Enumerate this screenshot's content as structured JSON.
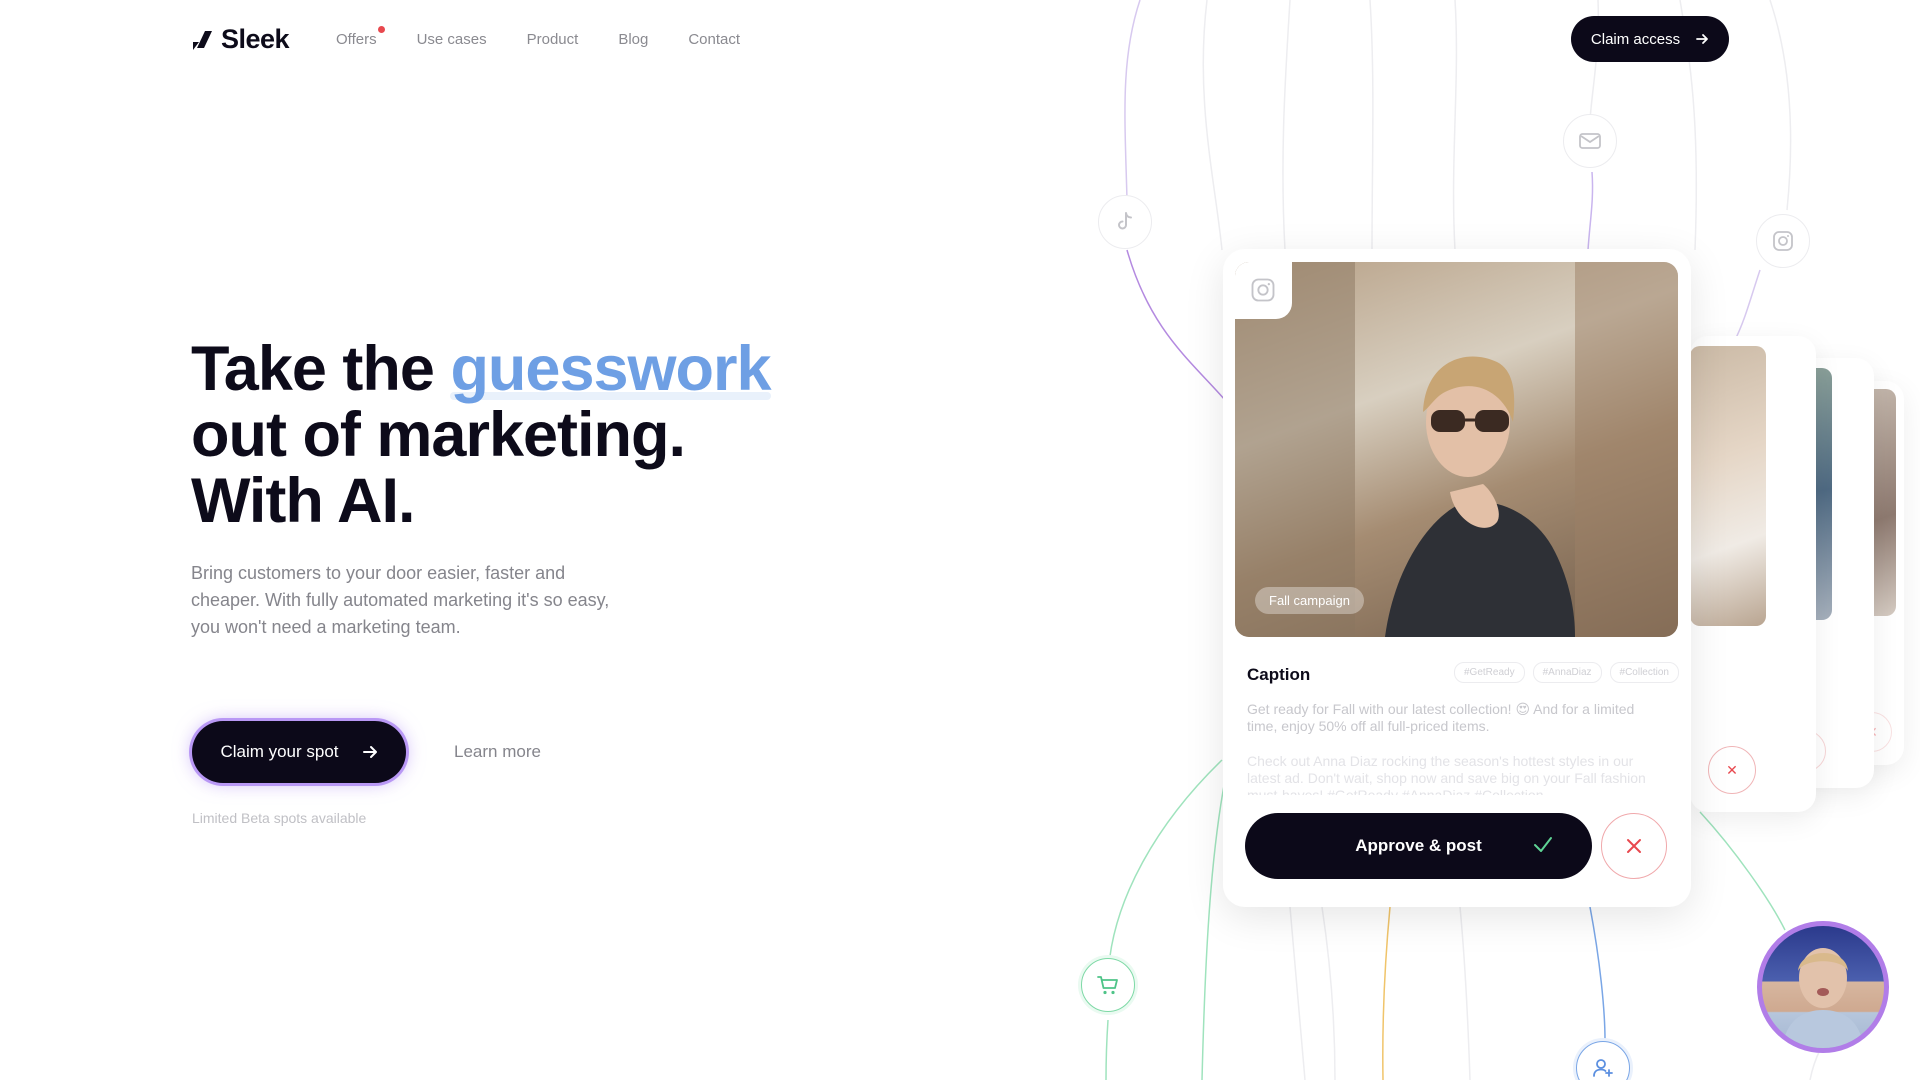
{
  "brand": {
    "name": "Sleek",
    "accent": "#6e9fe4",
    "dark": "#0c0919"
  },
  "nav": {
    "items": [
      {
        "label": "Offers",
        "has_dot": true
      },
      {
        "label": "Use cases"
      },
      {
        "label": "Product"
      },
      {
        "label": "Blog"
      },
      {
        "label": "Contact"
      }
    ],
    "cta_label": "Claim access"
  },
  "hero": {
    "title_line1_pre": "Take the ",
    "title_line1_accent": "guesswork",
    "title_line2": "out of marketing.",
    "title_line3": "With AI.",
    "subtitle": "Bring customers to your door easier, faster and cheaper. With fully automated marketing it's so easy, you won't need a marketing team.",
    "primary_cta": "Claim your spot",
    "secondary_cta": "Learn more",
    "note": "Limited Beta spots available"
  },
  "post_card": {
    "photo_tag": "Fall campaign",
    "caption_title": "Caption",
    "hashtags": [
      "#GetReady",
      "#AnnaDiaz",
      "#Collection"
    ],
    "caption_text": "Get ready for Fall with our latest collection! 😍 And for a limited time, enjoy 50% off all full-priced items.",
    "caption_text_2": "Check out Anna Diaz rocking the season's hottest styles in our latest ad. Don't wait, shop now and save big on your Fall fashion must-haves! #GetReady #AnnaDiaz #Collection",
    "approve_label": "Approve & post"
  },
  "icons": [
    "tiktok-icon",
    "mail-icon",
    "instagram-icon",
    "cart-icon",
    "add-user-icon"
  ]
}
